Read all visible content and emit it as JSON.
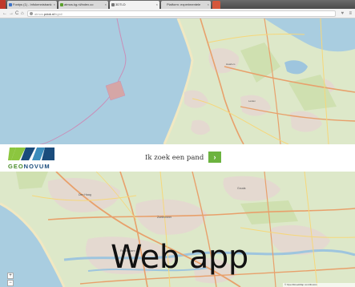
{
  "browser": {
    "tabs": [
      {
        "label": "Fontys (1) - Infokennisbank",
        "active": false,
        "favicon_color": "#e84d1c"
      },
      {
        "label": "atmos.kg.nl/index.co",
        "active": false,
        "favicon_color": "#3b73c8"
      },
      {
        "label": "3DTLD",
        "active": true,
        "favicon_color": "#5aa02c"
      },
      {
        "label": "Platform: experimentele",
        "active": false,
        "favicon_color": "#777777"
      }
    ],
    "nav": {
      "back": "←",
      "forward": "→",
      "reload": "C",
      "home": "⌂"
    },
    "address": {
      "scheme": "atmos.",
      "host": "pdok.nl",
      "path": "/bgtd/"
    },
    "star": "♥",
    "menu": "≡"
  },
  "search": {
    "label": "Ik zoek een pand",
    "button": "›"
  },
  "logo": {
    "text_part1": "GEO",
    "text_part2": "NOVUM",
    "colors": [
      "#8cc63f",
      "#1a4c7c",
      "#3c8dbc",
      "#1a4c7c"
    ]
  },
  "overlay": {
    "title": "Web app"
  },
  "map_controls": {
    "zoom_in": "+",
    "zoom_out": "−"
  },
  "attribution": "© OpenStreetMap contributors",
  "colors": {
    "sea": "#a9cde0",
    "land": "#dde8c9",
    "urban": "#e4d9d0",
    "road_major": "#e8a06b",
    "road_minor": "#f6d77a",
    "water": "#9ec5de",
    "brand_green": "#6cb33f"
  }
}
